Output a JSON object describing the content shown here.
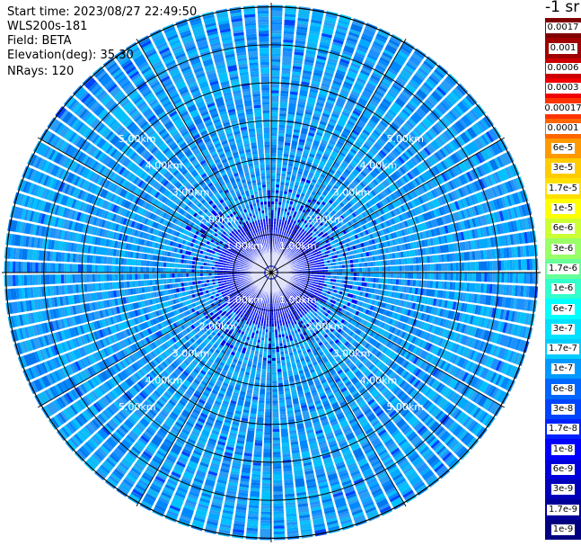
{
  "info": {
    "start_time": "Start time: 2023/08/27 22:49:50",
    "instrument": "WLS200s-181",
    "field": "Field: BETA",
    "elevation": "Elevation(deg): 35.30",
    "nrays": "NRays: 120"
  },
  "colorbar": {
    "title": "-1 sr",
    "labels": [
      "0.0017",
      "0.001",
      "0.0006",
      "0.0003",
      "0.00017",
      "0.0001",
      "6e-5",
      "3e-5",
      "1.7e-5",
      "1e-5",
      "6e-6",
      "3e-6",
      "1.7e-6",
      "1e-6",
      "6e-7",
      "3e-7",
      "1.7e-7",
      "1e-7",
      "6e-8",
      "3e-8",
      "1.7e-8",
      "1e-8",
      "6e-9",
      "3e-9",
      "1.7e-9",
      "1e-9"
    ],
    "colors": [
      "#800000",
      "#a00000",
      "#cc0000",
      "#f00000",
      "#ff3300",
      "#ff6600",
      "#ff9900",
      "#ffcc00",
      "#ffe000",
      "#ffff00",
      "#ccff33",
      "#99ff66",
      "#66ff99",
      "#33ffcc",
      "#00ffff",
      "#00e0ff",
      "#00ccff",
      "#0099ff",
      "#0066ff",
      "#0044ff",
      "#0022ff",
      "#0000ff",
      "#0000dd",
      "#0000bb",
      "#000099",
      "#000080"
    ]
  },
  "chart_data": {
    "type": "heatmap",
    "projection": "polar",
    "n_rays": 120,
    "range_rings_km": [
      1,
      2,
      3,
      4,
      5
    ],
    "range_ring_labels": [
      "1.00km",
      "2.00km",
      "3.00km",
      "4.00km",
      "5.00km"
    ],
    "max_range_km": 7,
    "value_range": [
      "1e-9",
      "0.0017"
    ],
    "dominant_far_field": "1e-7 to 6e-8",
    "dominant_near_field": "1e-8 to 1.7e-9",
    "grid": true
  }
}
